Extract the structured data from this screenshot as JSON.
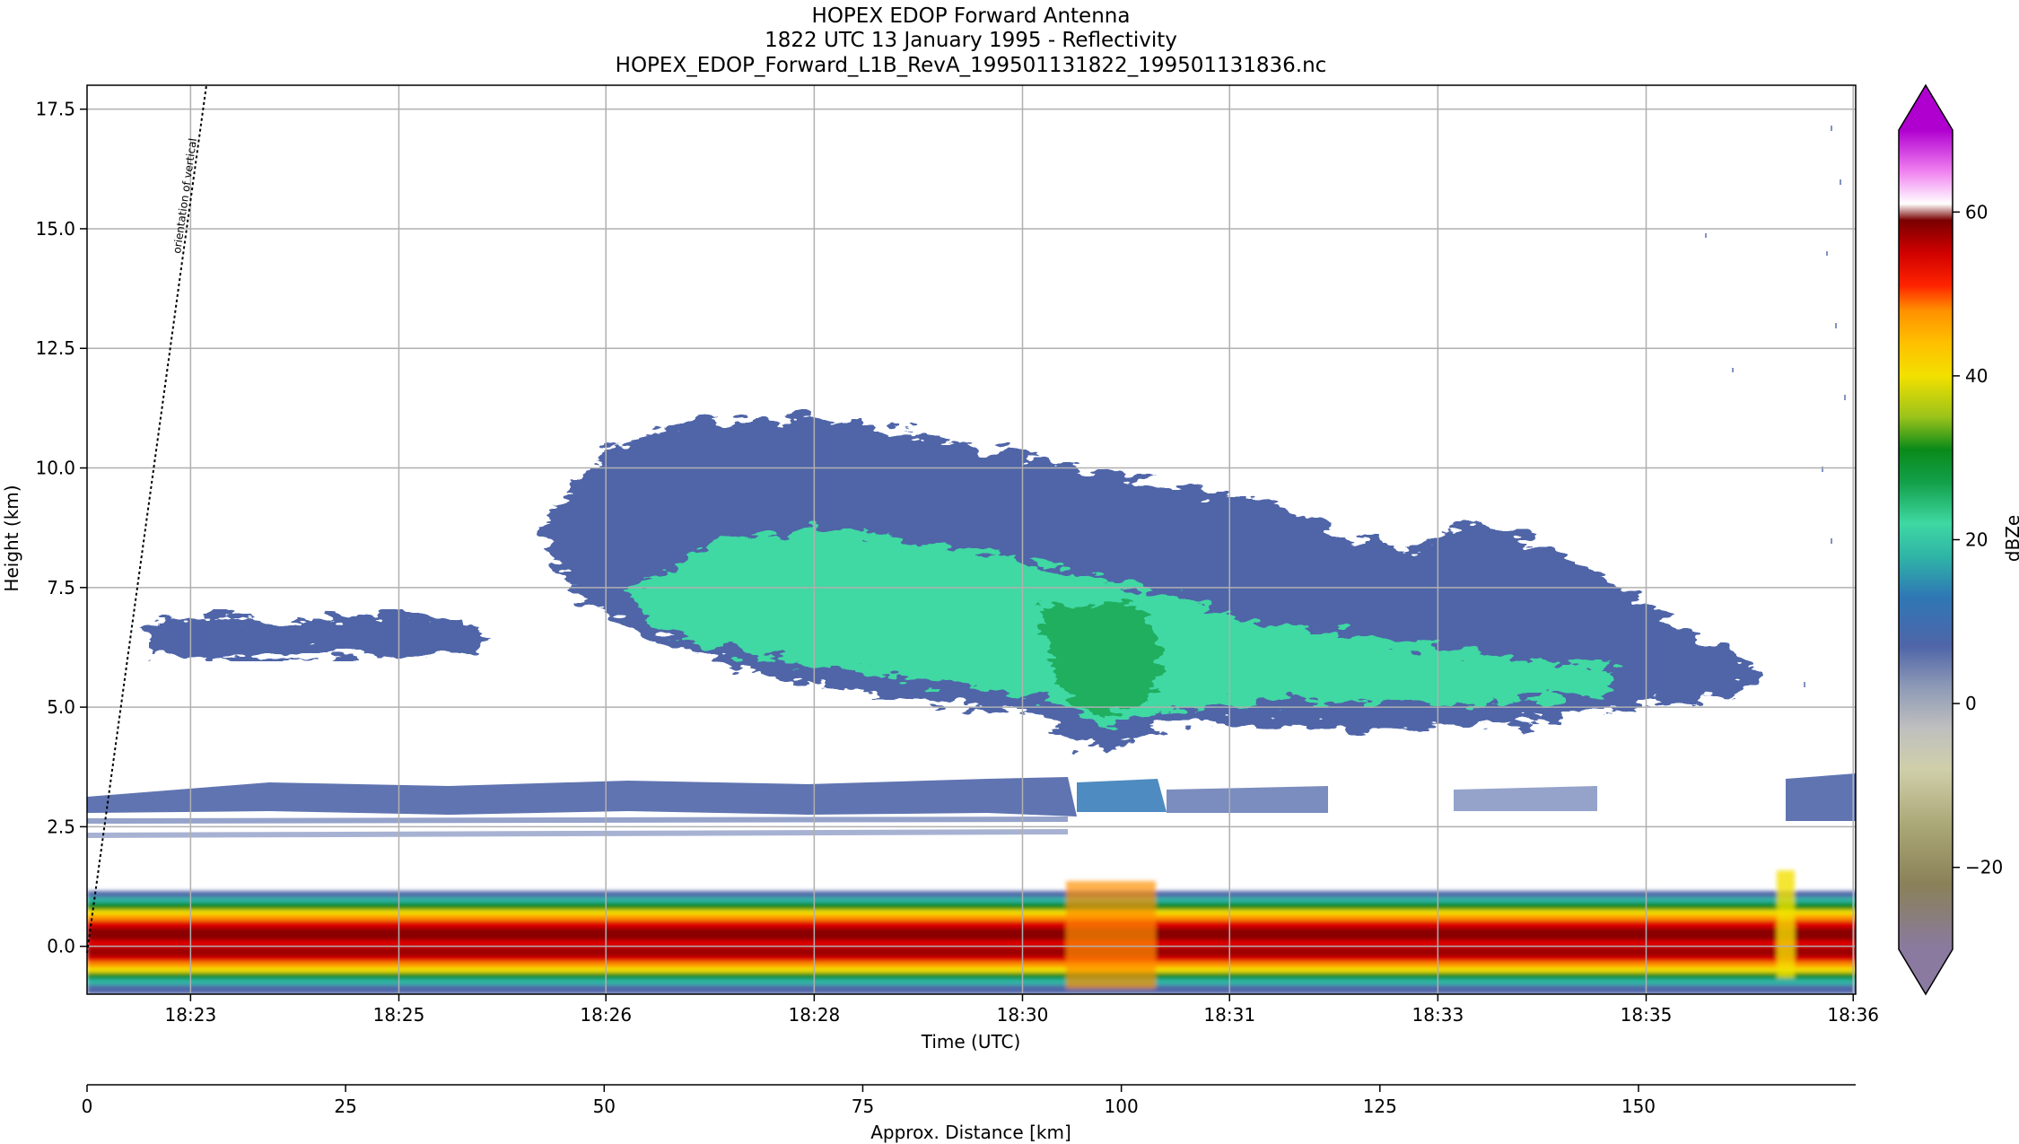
{
  "chart_data": {
    "type": "heatmap",
    "title_lines": [
      "HOPEX EDOP Forward Antenna",
      "1822 UTC 13 January 1995 - Reflectivity",
      "HOPEX_EDOP_Forward_L1B_RevA_199501131822_199501131836.nc"
    ],
    "xlabel": "Time (UTC)",
    "ylabel": "Height (km)",
    "x_time_range_min": [
      22.17,
      36.35
    ],
    "x_ticks": [
      {
        "t": 23,
        "label": "18:23"
      },
      {
        "t": 24.67,
        "label": "18:25"
      },
      {
        "t": 26.33,
        "label": "18:26"
      },
      {
        "t": 28,
        "label": "18:28"
      },
      {
        "t": 29.67,
        "label": "18:30"
      },
      {
        "t": 31.33,
        "label": "18:31"
      },
      {
        "t": 33,
        "label": "18:33"
      },
      {
        "t": 34.67,
        "label": "18:35"
      },
      {
        "t": 36.33,
        "label": "18:36"
      }
    ],
    "ylim": [
      -1.0,
      18.0
    ],
    "y_ticks": [
      {
        "v": 0,
        "label": "0.0"
      },
      {
        "v": 2.5,
        "label": "2.5"
      },
      {
        "v": 5,
        "label": "5.0"
      },
      {
        "v": 7.5,
        "label": "7.5"
      },
      {
        "v": 10,
        "label": "10.0"
      },
      {
        "v": 12.5,
        "label": "12.5"
      },
      {
        "v": 15,
        "label": "15.0"
      },
      {
        "v": 17.5,
        "label": "17.5"
      }
    ],
    "grid": true,
    "annotation": "orientation of vertical",
    "distance_axis": {
      "label": "Approx. Distance [km]",
      "range": [
        0,
        171
      ],
      "ticks": [
        {
          "v": 0,
          "label": "0"
        },
        {
          "v": 25,
          "label": "25"
        },
        {
          "v": 50,
          "label": "50"
        },
        {
          "v": 75,
          "label": "75"
        },
        {
          "v": 100,
          "label": "100"
        },
        {
          "v": 125,
          "label": "125"
        },
        {
          "v": 150,
          "label": "150"
        }
      ]
    },
    "colorbar": {
      "label": "dBZe",
      "range": [
        -30,
        70
      ],
      "ticks": [
        {
          "v": -20,
          "label": "−20"
        },
        {
          "v": 0,
          "label": "0"
        },
        {
          "v": 20,
          "label": "20"
        },
        {
          "v": 40,
          "label": "40"
        },
        {
          "v": 60,
          "label": "60"
        }
      ],
      "stops": [
        {
          "v": -30,
          "color": "#8a7aa0"
        },
        {
          "v": -22,
          "color": "#8a8158"
        },
        {
          "v": -15,
          "color": "#aaa776"
        },
        {
          "v": -8,
          "color": "#cfcfaa"
        },
        {
          "v": -3,
          "color": "#bfbfbf"
        },
        {
          "v": 2,
          "color": "#8e9ab6"
        },
        {
          "v": 7,
          "color": "#4f65a8"
        },
        {
          "v": 13,
          "color": "#2f77b5"
        },
        {
          "v": 18,
          "color": "#2fb5a6"
        },
        {
          "v": 22,
          "color": "#3fd8a3"
        },
        {
          "v": 27,
          "color": "#13a04a"
        },
        {
          "v": 31,
          "color": "#0a8a1a"
        },
        {
          "v": 35,
          "color": "#9bc31a"
        },
        {
          "v": 40,
          "color": "#f2e000"
        },
        {
          "v": 44,
          "color": "#ffc000"
        },
        {
          "v": 48,
          "color": "#ff9000"
        },
        {
          "v": 51,
          "color": "#ff2400"
        },
        {
          "v": 55,
          "color": "#d00000"
        },
        {
          "v": 59,
          "color": "#7a0000"
        },
        {
          "v": 61,
          "color": "#ffffff"
        },
        {
          "v": 65,
          "color": "#f080f0"
        },
        {
          "v": 70,
          "color": "#b000d0"
        }
      ]
    },
    "features": [
      {
        "name": "surface return band",
        "t_start": 22.17,
        "t_end": 36.35,
        "height_km": [
          -0.9,
          1.1
        ],
        "peak_dBZe": 58
      },
      {
        "name": "thin layer cloud",
        "t_start": 22.7,
        "t_end": 25.8,
        "height_km": [
          6.0,
          6.9
        ],
        "peak_dBZe": 10
      },
      {
        "name": "deep stratiform cloud",
        "t_start": 26.0,
        "t_end": 35.7,
        "height_km": [
          4.5,
          11.0
        ],
        "peak_dBZe": 26
      },
      {
        "name": "low-level layer",
        "t_start": 22.17,
        "t_end": 34.3,
        "height_km": [
          2.1,
          3.4
        ],
        "peak_dBZe": 12
      }
    ]
  }
}
